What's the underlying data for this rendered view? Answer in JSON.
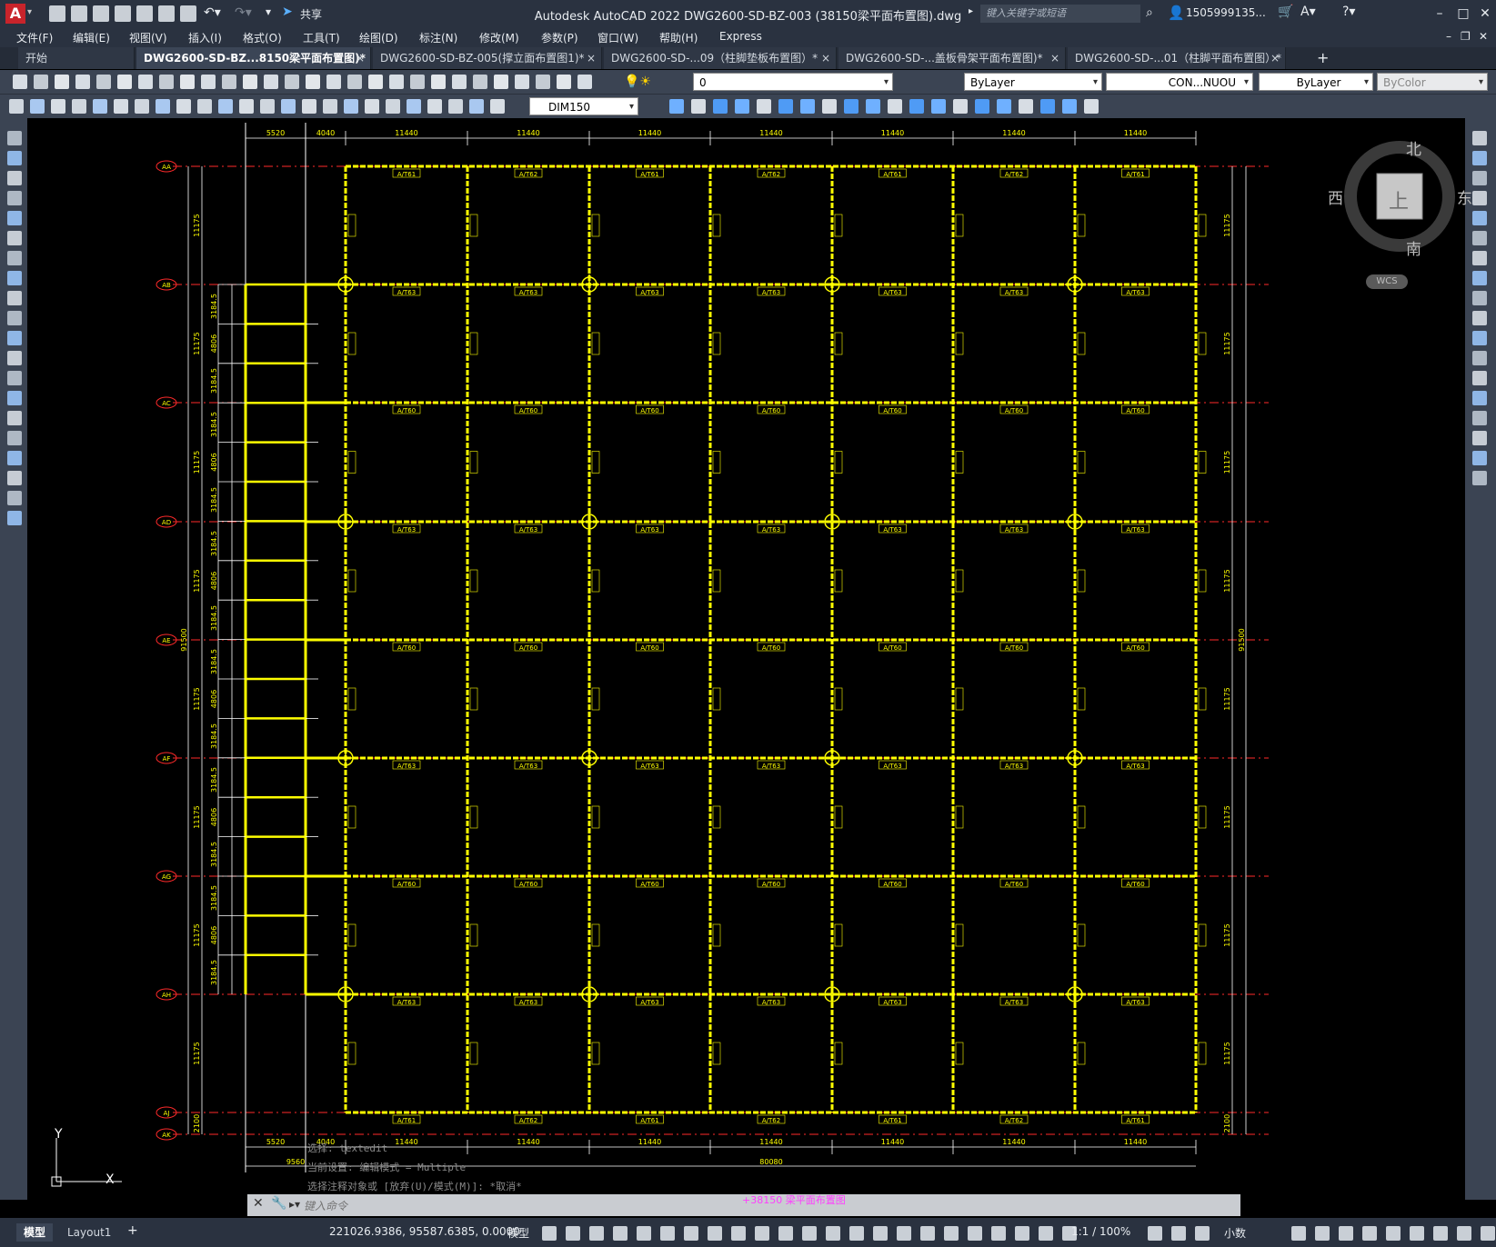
{
  "app": {
    "title": "Autodesk AutoCAD 2022    DWG2600-SD-BZ-003 (38150梁平面布置图).dwg",
    "search_placeholder": "键入关键字或短语",
    "user": "1505999135...",
    "share_label": "共享"
  },
  "menu": [
    "文件(F)",
    "编辑(E)",
    "视图(V)",
    "插入(I)",
    "格式(O)",
    "工具(T)",
    "绘图(D)",
    "标注(N)",
    "修改(M)",
    "参数(P)",
    "窗口(W)",
    "帮助(H)",
    "Express"
  ],
  "tabs": [
    {
      "label": "开始",
      "close": ""
    },
    {
      "label": "DWG2600-SD-BZ...8150梁平面布置图)*",
      "close": "×"
    },
    {
      "label": "DWG2600-SD-BZ-005(撑立面布置图1)*",
      "close": "×"
    },
    {
      "label": "DWG2600-SD-...09（柱脚垫板布置图）*",
      "close": "×"
    },
    {
      "label": "DWG2600-SD-...盖板骨架平面布置图)*",
      "close": "×"
    },
    {
      "label": "DWG2600-SD-...01（柱脚平面布置图）*",
      "close": "×"
    }
  ],
  "properties": {
    "layer": "0",
    "color": "ByLayer",
    "linetype": "CON...NUOU",
    "lineweight": "ByLayer",
    "plotstyle": "ByColor",
    "dimstyle": "DIM150"
  },
  "viewcube": {
    "north": "北",
    "south": "南",
    "east": "东",
    "west": "西",
    "face": "上",
    "wcs": "WCS"
  },
  "drawing": {
    "top_dims": [
      "5520",
      "4040",
      "11440",
      "11440",
      "11440",
      "11440",
      "11440",
      "11440",
      "11440"
    ],
    "bottom_dims": [
      "5520",
      "4040",
      "11440",
      "11440",
      "11440",
      "11440",
      "11440",
      "11440",
      "11440"
    ],
    "bottom_totals": [
      "9560",
      "80080"
    ],
    "grid_rows": [
      "AA",
      "AB",
      "AC",
      "AD",
      "AE",
      "AF",
      "AG",
      "AH",
      "AJ",
      "AK"
    ],
    "left_total": "91500",
    "right_total": "91500",
    "row_dim": "11175",
    "end_dim": "2100",
    "sub_dims": [
      "3184.5",
      "4806"
    ],
    "beam_labels_top": [
      "A/T61",
      "A/T62",
      "A/T61",
      "A/T62",
      "A/T61",
      "A/T62",
      "A/T61"
    ],
    "beam_labels_row": [
      "A/T63",
      "A/T63",
      "A/T63",
      "A/T63",
      "A/T63",
      "A/T63",
      "A/T63"
    ],
    "beam_labels_mid": [
      "A/T60",
      "A/T60",
      "A/T60",
      "A/T60",
      "A/T60",
      "A/T60",
      "A/T60"
    ],
    "title_label": "+38150 梁平面布置图"
  },
  "command": {
    "history": [
      "选择: textedit",
      "当前设置: 编辑模式 = Multiple",
      "选择注释对象或 [放弃(U)/模式(M)]: *取消*"
    ],
    "placeholder": "键入命令"
  },
  "status": {
    "layouts": [
      "模型",
      "Layout1"
    ],
    "coords": "221026.9386, 95587.6385, 0.0000",
    "model": "模型",
    "scale": "1:1 / 100%",
    "units": "小数"
  },
  "ucs": {
    "x": "X",
    "y": "Y"
  }
}
